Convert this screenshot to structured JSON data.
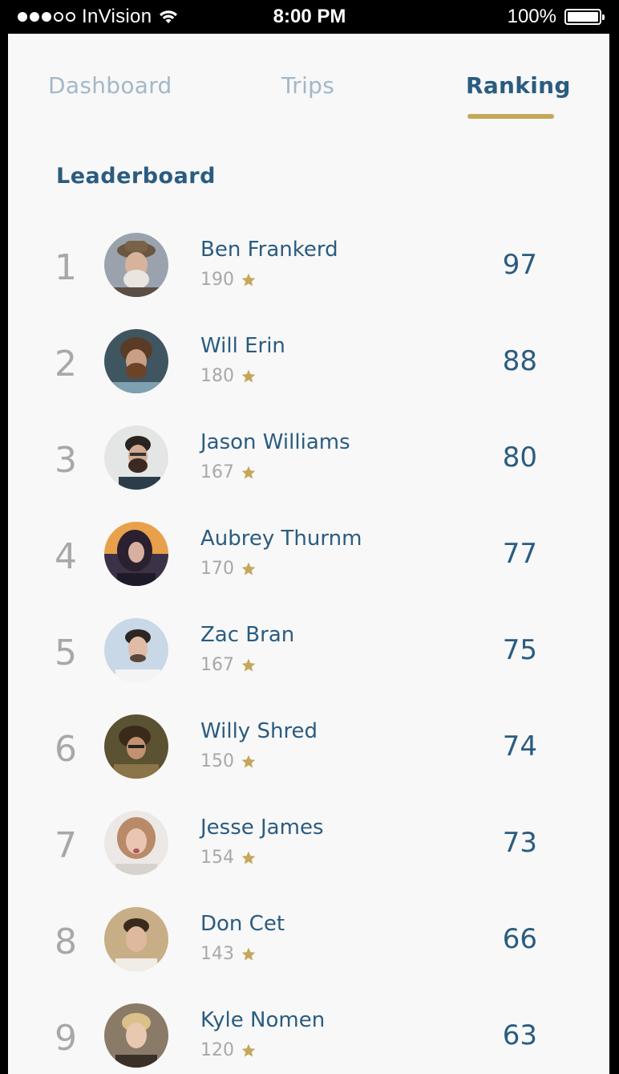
{
  "status_bar": {
    "carrier": "InVision",
    "time": "8:00 PM",
    "battery": "100%",
    "signal_icon": "signal-dots-icon",
    "wifi_icon": "wifi-icon",
    "battery_icon": "battery-icon"
  },
  "tabs": [
    {
      "label": "Dashboard",
      "active": false
    },
    {
      "label": "Trips",
      "active": false
    },
    {
      "label": "Ranking",
      "active": true
    }
  ],
  "colors": {
    "accent": "#c4a85a",
    "primary_text": "#2a5c80",
    "inactive_tab": "#a3b8c9",
    "muted": "#a8a8a8",
    "background": "#f8f8f8"
  },
  "leaderboard": {
    "title": "Leaderboard",
    "star_icon": "star-icon",
    "entries": [
      {
        "rank": "1",
        "name": "Ben Frankerd",
        "stars": "190",
        "score": "97"
      },
      {
        "rank": "2",
        "name": "Will Erin",
        "stars": "180",
        "score": "88"
      },
      {
        "rank": "3",
        "name": "Jason Williams",
        "stars": "167",
        "score": "80"
      },
      {
        "rank": "4",
        "name": "Aubrey Thurnm",
        "stars": "170",
        "score": "77"
      },
      {
        "rank": "5",
        "name": "Zac Bran",
        "stars": "167",
        "score": "75"
      },
      {
        "rank": "6",
        "name": "Willy Shred",
        "stars": "150",
        "score": "74"
      },
      {
        "rank": "7",
        "name": "Jesse James",
        "stars": "154",
        "score": "73"
      },
      {
        "rank": "8",
        "name": "Don Cet",
        "stars": "143",
        "score": "66"
      },
      {
        "rank": "9",
        "name": "Kyle Nomen",
        "stars": "120",
        "score": "63"
      }
    ]
  }
}
